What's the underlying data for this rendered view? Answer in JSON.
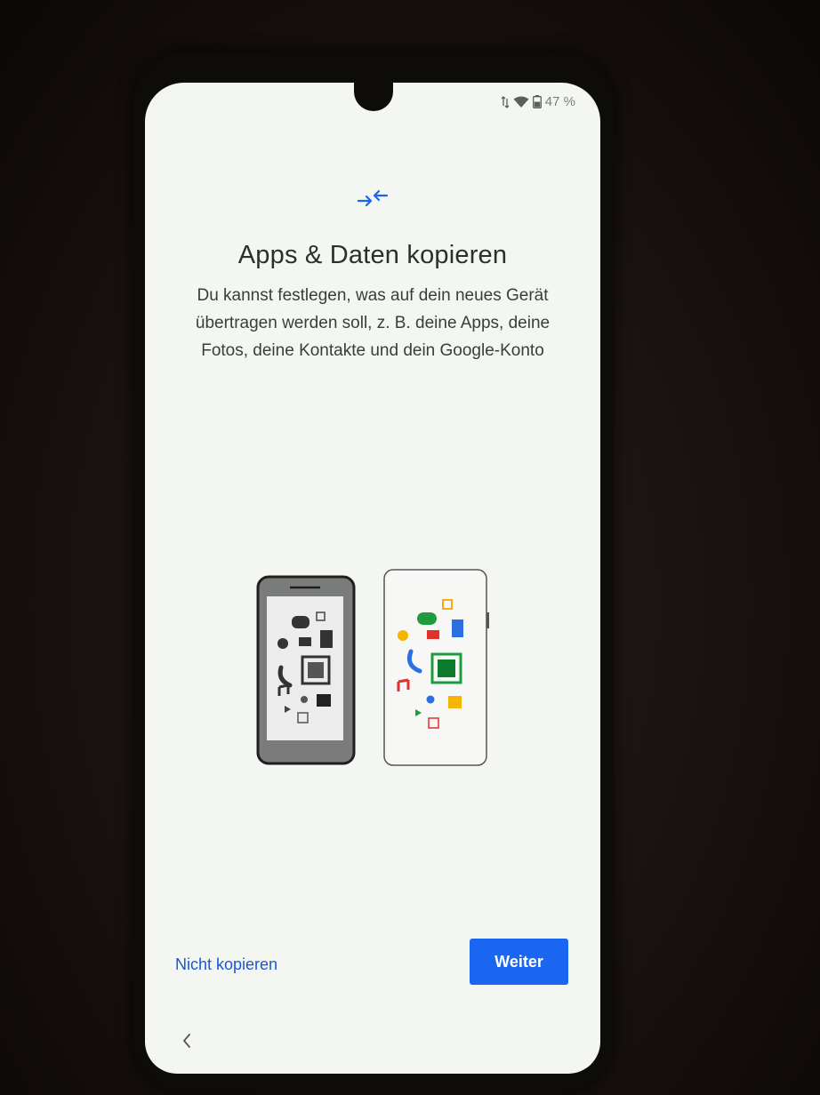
{
  "status_bar": {
    "battery": "47 %"
  },
  "setup": {
    "title": "Apps & Daten kopieren",
    "description": "Du kannst festlegen, was auf dein neues Gerät übertragen werden soll, z. B. deine Apps, deine Fotos, deine Kontakte und dein Google-Konto"
  },
  "actions": {
    "skip_label": "Nicht kopieren",
    "next_label": "Weiter"
  },
  "colors": {
    "accent": "#1a66f0",
    "link": "#1a56d6",
    "screen_bg": "#f4f7f1"
  },
  "icons": [
    "transfer-arrows-icon",
    "wifi-icon",
    "battery-icon",
    "back-icon",
    "phone-transfer-illustration"
  ]
}
